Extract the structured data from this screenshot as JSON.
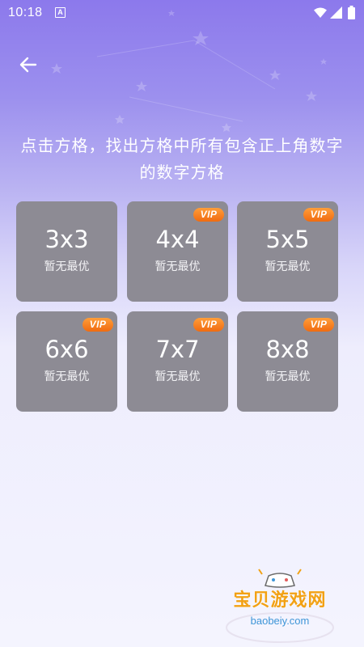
{
  "status_bar": {
    "time": "10:18",
    "notification_glyph": "A",
    "icons": [
      "wifi-icon",
      "signal-icon",
      "battery-icon"
    ]
  },
  "header": {
    "back_icon": "arrow-left-icon"
  },
  "instruction": {
    "text": "点击方格，找出方格中所有包含正上角数字的数字方格"
  },
  "levels": [
    {
      "size": "3x3",
      "best": "暂无最优",
      "vip": false
    },
    {
      "size": "4x4",
      "best": "暂无最优",
      "vip": true
    },
    {
      "size": "5x5",
      "best": "暂无最优",
      "vip": true
    },
    {
      "size": "6x6",
      "best": "暂无最优",
      "vip": true
    },
    {
      "size": "7x7",
      "best": "暂无最优",
      "vip": true
    },
    {
      "size": "8x8",
      "best": "暂无最优",
      "vip": true
    }
  ],
  "vip_label": "VIP",
  "watermark": {
    "name": "宝贝游戏网",
    "url": "baobeiy.com",
    "icon": "gamepad-icon"
  },
  "colors": {
    "tile": "#8d8b94",
    "vip": "#f47a1c",
    "watermark_text": "#f2a114",
    "watermark_url": "#3f96d8"
  }
}
